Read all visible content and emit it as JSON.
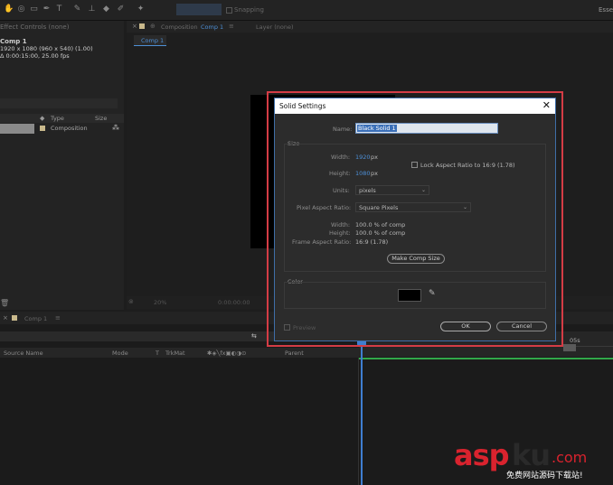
{
  "project_panel": {
    "tab": "Effect Controls (none)",
    "comp_name": "Comp 1",
    "comp_size": "1920 x 1080  (960 x 540) (1.00)",
    "comp_duration": "Δ 0:00:15:00, 25.00 fps",
    "col_type": "Type",
    "col_size": "Size",
    "row_type": "Composition"
  },
  "comp_panel": {
    "tab_label": "Composition",
    "tab_comp": "Comp 1",
    "layer_tab": "Layer (none)",
    "subtab": "Comp 1",
    "zoom": "20%",
    "time": "0:00:00:00"
  },
  "toolbar": {
    "snapping": "Snapping",
    "workspace": "Essen"
  },
  "dialog": {
    "title": "Solid Settings",
    "name_label": "Name:",
    "name_value": "Black Solid 1",
    "size_group": "Size",
    "width_label": "Width:",
    "width_value": "1920",
    "width_unit": "px",
    "height_label": "Height:",
    "height_value": "1080",
    "height_unit": "px",
    "lock_label": "Lock Aspect Ratio to 16:9 (1.78)",
    "units_label": "Units:",
    "units_value": "pixels",
    "par_label": "Pixel Aspect Ratio:",
    "par_value": "Square Pixels",
    "width_pct_label": "Width:",
    "width_pct_value": "100.0 % of comp",
    "height_pct_label": "Height:",
    "height_pct_value": "100.0 % of comp",
    "far_label": "Frame Aspect Ratio:",
    "far_value": "16:9 (1.78)",
    "make_comp_size": "Make Comp Size",
    "color_group": "Color",
    "color_value": "#000000",
    "preview_label": "Preview",
    "ok_label": "OK",
    "cancel_label": "Cancel"
  },
  "timeline": {
    "tab": "Comp 1",
    "col_source": "Source Name",
    "col_mode": "Mode",
    "col_t": "T",
    "col_trkmat": "TrkMat",
    "col_parent": "Parent",
    "ruler_mark": "05s"
  },
  "watermark": {
    "brand_a": "asp",
    "brand_b": "ku",
    "brand_tld": ".com",
    "tagline": "免费网站源码下载站!"
  }
}
